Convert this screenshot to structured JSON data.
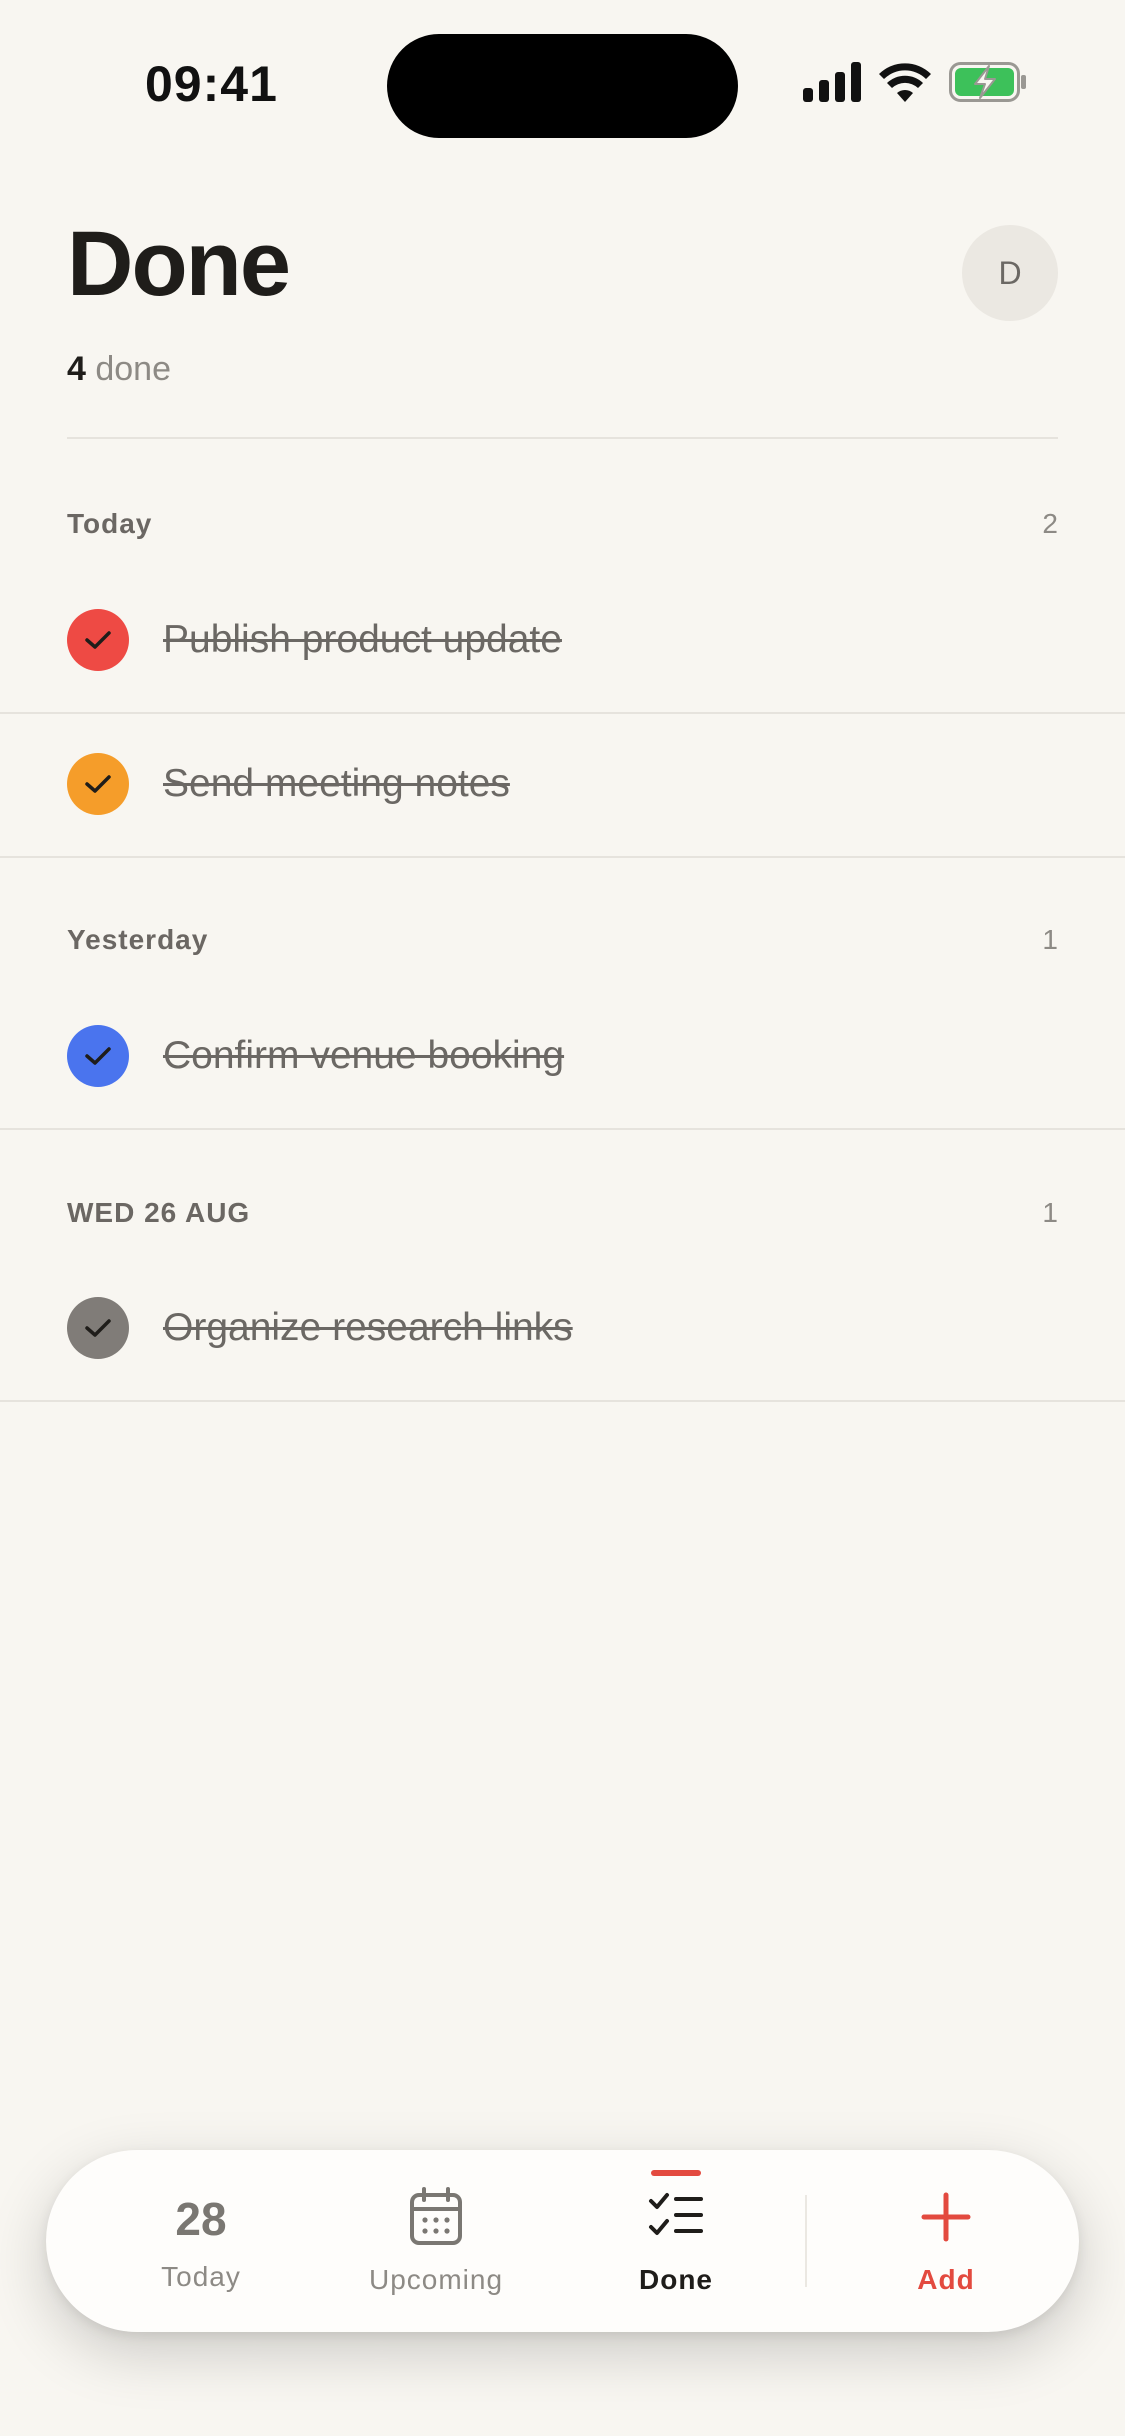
{
  "status_bar": {
    "time": "09:41"
  },
  "header": {
    "title": "Done",
    "avatar_initial": "D",
    "done_count": "4",
    "done_suffix": " done"
  },
  "sections": [
    {
      "title": "Today",
      "count": "2",
      "tasks": [
        {
          "label": "Publish product update",
          "color": "#ee4a44"
        },
        {
          "label": "Send meeting notes",
          "color": "#f59d2a"
        }
      ]
    },
    {
      "title": "Yesterday",
      "count": "1",
      "tasks": [
        {
          "label": "Confirm venue booking",
          "color": "#4a74ee"
        }
      ]
    },
    {
      "title": "WED 26 AUG",
      "count": "1",
      "tasks": [
        {
          "label": "Organize research links",
          "color": "#807c78"
        }
      ]
    }
  ],
  "tab_bar": {
    "today_number": "28",
    "today_label": "Today",
    "upcoming_label": "Upcoming",
    "done_label": "Done",
    "add_label": "Add",
    "active_tab": "Done",
    "accent_color": "#e34a3f"
  }
}
